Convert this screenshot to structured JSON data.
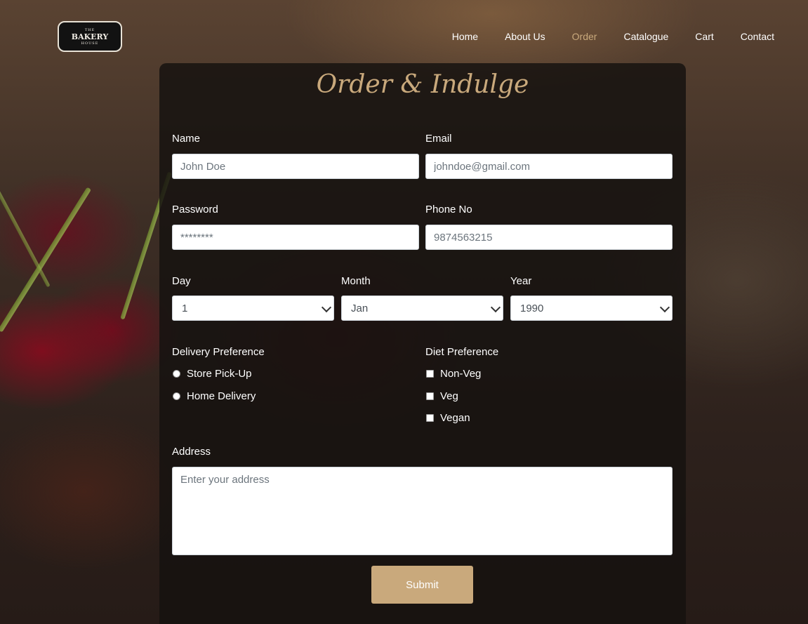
{
  "brand": {
    "logo_top": "THE",
    "logo_main": "BAKERY",
    "logo_bottom": "HOUSE"
  },
  "nav": [
    {
      "label": "Home",
      "active": false
    },
    {
      "label": "About Us",
      "active": false
    },
    {
      "label": "Order",
      "active": true
    },
    {
      "label": "Catalogue",
      "active": false
    },
    {
      "label": "Cart",
      "active": false
    },
    {
      "label": "Contact",
      "active": false
    }
  ],
  "form": {
    "title": "Order & Indulge",
    "name": {
      "label": "Name",
      "placeholder": "John Doe"
    },
    "email": {
      "label": "Email",
      "placeholder": "johndoe@gmail.com"
    },
    "password": {
      "label": "Password",
      "placeholder": "********"
    },
    "phone": {
      "label": "Phone No",
      "placeholder": "9874563215"
    },
    "day": {
      "label": "Day",
      "value": "1"
    },
    "month": {
      "label": "Month",
      "value": "Jan"
    },
    "year": {
      "label": "Year",
      "value": "1990"
    },
    "delivery": {
      "label": "Delivery Preference",
      "options": [
        "Store Pick-Up",
        "Home Delivery"
      ]
    },
    "diet": {
      "label": "Diet Preference",
      "options": [
        "Non-Veg",
        "Veg",
        "Vegan"
      ]
    },
    "address": {
      "label": "Address",
      "placeholder": "Enter your address"
    },
    "submit_label": "Submit"
  },
  "colors": {
    "accent": "#c9a97c",
    "card_bg": "#16120f",
    "text": "#ffffff"
  }
}
